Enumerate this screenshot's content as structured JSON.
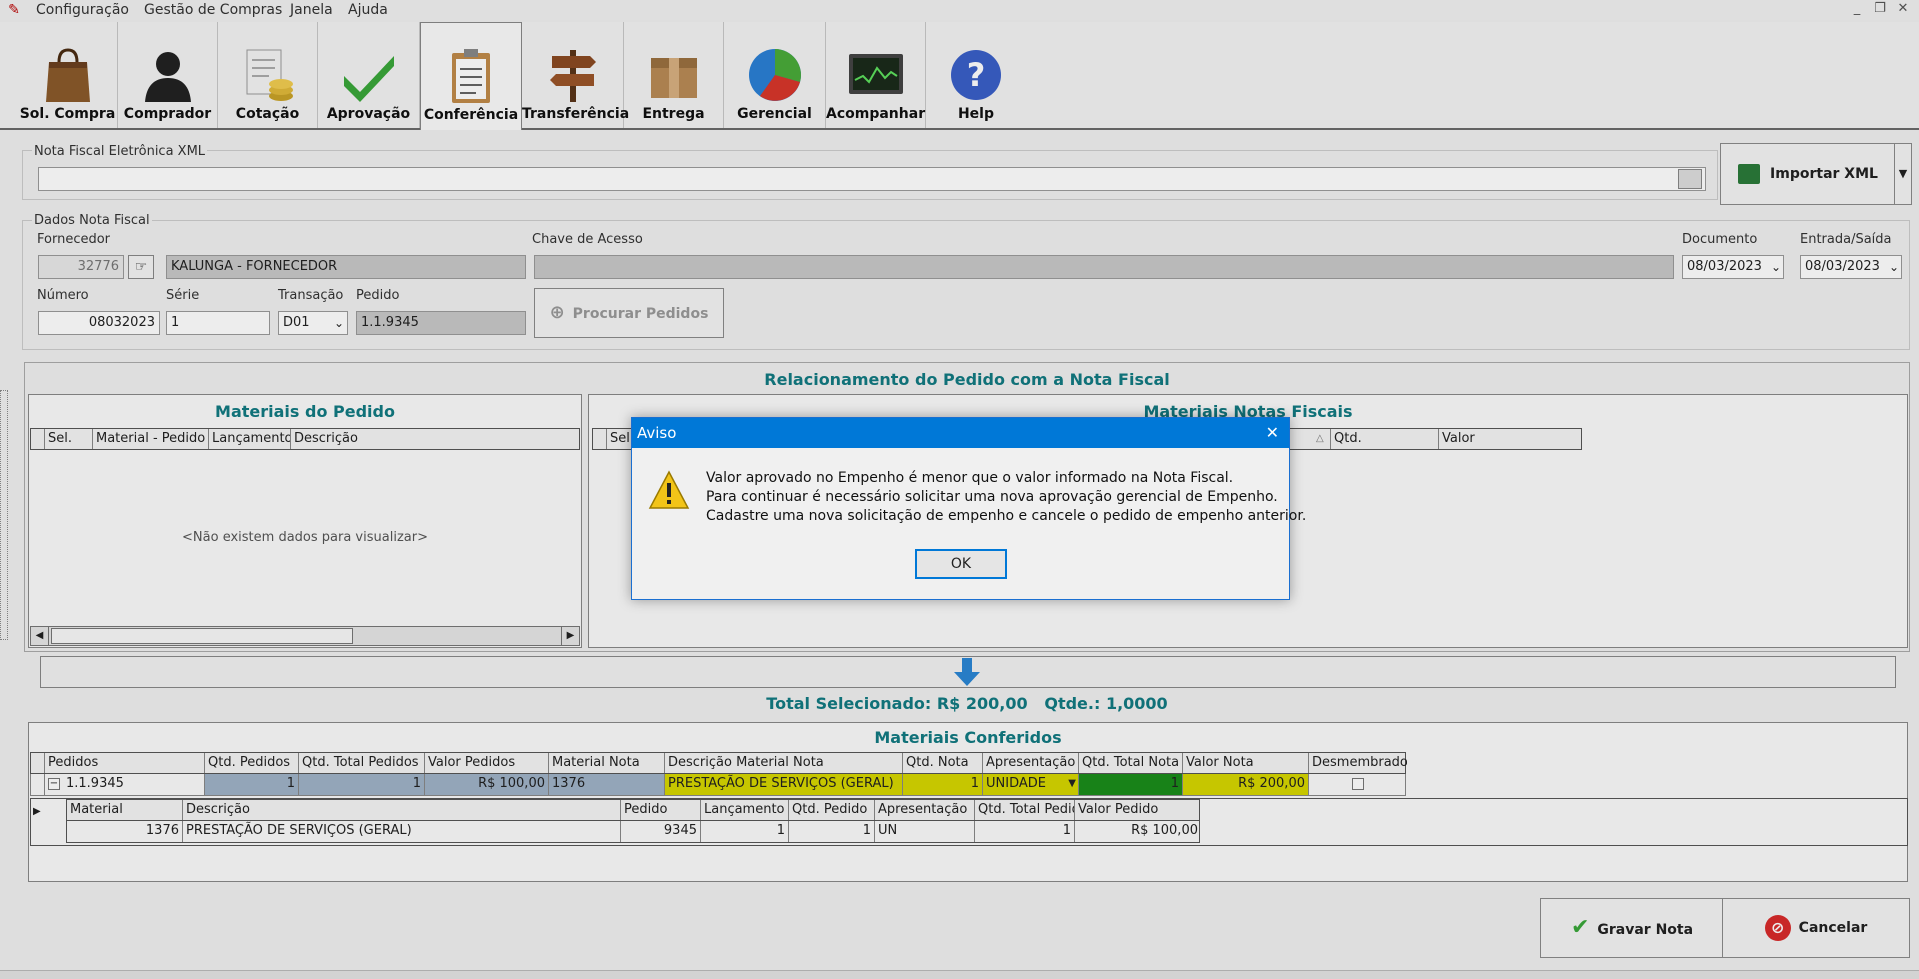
{
  "menu": {
    "items": [
      "Configuração",
      "Gestão de Compras",
      "Janela",
      "Ajuda"
    ],
    "window_buttons": [
      "_",
      "❐",
      "✕"
    ]
  },
  "toolbar": {
    "buttons": [
      {
        "label": "Sol. Compra",
        "icon": "shopping-bag-icon"
      },
      {
        "label": "Comprador",
        "icon": "person-icon"
      },
      {
        "label": "Cotação",
        "icon": "coins-document-icon"
      },
      {
        "label": "Aprovação",
        "icon": "checkmark-icon"
      },
      {
        "label": "Conferência",
        "icon": "clipboard-icon"
      },
      {
        "label": "Transferência",
        "icon": "signpost-icon"
      },
      {
        "label": "Entrega",
        "icon": "package-icon"
      },
      {
        "label": "Gerencial",
        "icon": "pie-chart-icon"
      },
      {
        "label": "Acompanhar",
        "icon": "monitor-chart-icon"
      },
      {
        "label": "Help",
        "icon": "help-icon"
      }
    ],
    "active": "Conferência"
  },
  "xml": {
    "label": "Nota Fiscal Eletrônica XML",
    "value": "",
    "import_button": "Importar XML"
  },
  "dados": {
    "group_label": "Dados Nota Fiscal",
    "fornecedor_label": "Fornecedor",
    "fornecedor_code": "32776",
    "fornecedor_name": "KALUNGA - FORNECEDOR",
    "chave_label": "Chave de Acesso",
    "chave_value": "",
    "documento_label": "Documento",
    "documento_value": "08/03/2023",
    "entrada_label": "Entrada/Saída",
    "entrada_value": "08/03/2023",
    "numero_label": "Número",
    "numero_value": "08032023",
    "serie_label": "Série",
    "serie_value": "1",
    "transacao_label": "Transação",
    "transacao_value": "D01",
    "pedido_label": "Pedido",
    "pedido_value": "1.1.9345",
    "procurar_button": "Procurar Pedidos"
  },
  "relacionamento": {
    "title": "Relacionamento do Pedido com a Nota Fiscal",
    "materiais_pedido": {
      "title": "Materiais do Pedido",
      "columns": [
        "Sel.",
        "Material - Pedido",
        "Lançamento",
        "Descrição"
      ],
      "empty_text": "<Não existem dados para visualizar>"
    },
    "materiais_notas": {
      "title": "Materiais Notas Fiscais",
      "columns": [
        "Sel.",
        "Qtd.",
        "Valor"
      ]
    }
  },
  "total": {
    "text": "Total Selecionado: R$ 200,00",
    "qtde": "Qtde.: 1,0000"
  },
  "conferidos": {
    "title": "Materiais Conferidos",
    "columns": [
      "Pedidos",
      "Qtd. Pedidos",
      "Qtd. Total Pedidos",
      "Valor Pedidos",
      "Material Nota",
      "Descrição Material Nota",
      "Qtd. Nota",
      "Apresentação",
      "Qtd. Total Nota",
      "Valor Nota",
      "Desmembrado"
    ],
    "row": {
      "expander": "−",
      "pedido": "1.1.9345",
      "qtd_pedidos": "1",
      "qtd_total_pedidos": "1",
      "valor_pedidos": "R$ 100,00",
      "material_nota": "1376",
      "descricao": "PRESTAÇÃO DE SERVIÇOS (GERAL)",
      "qtd_nota": "1",
      "apresentacao": "UNIDADE",
      "qtd_total_nota": "1",
      "valor_nota": "R$ 200,00"
    },
    "sub_columns": [
      "Material",
      "Descrição",
      "Pedido",
      "Lançamento",
      "Qtd. Pedido",
      "Apresentação",
      "Qtd. Total Pedido",
      "Valor Pedido"
    ],
    "sub_row": {
      "material": "1376",
      "descricao": "PRESTAÇÃO DE SERVIÇOS (GERAL)",
      "pedido": "9345",
      "lancamento": "1",
      "qtd_pedido": "1",
      "apresentacao": "UN",
      "qtd_total_pedido": "1",
      "valor_pedido": "R$ 100,00"
    }
  },
  "actions": {
    "gravar": "Gravar Nota",
    "cancelar": "Cancelar"
  },
  "dialog": {
    "title": "Aviso",
    "close": "✕",
    "lines": [
      "Valor aprovado no Empenho é menor que o valor informado na Nota Fiscal.",
      "Para continuar é necessário solicitar uma nova aprovação gerencial de Empenho.",
      "Cadastre uma nova solicitação de empenho e cancele o pedido de empenho anterior."
    ],
    "ok": "OK"
  }
}
